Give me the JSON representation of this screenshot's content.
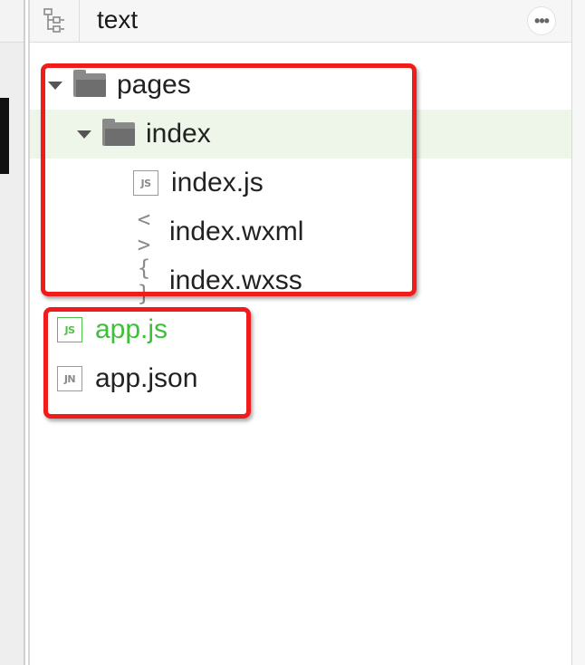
{
  "header": {
    "title": "text",
    "more_label": "•••"
  },
  "tree": {
    "pages": {
      "label": "pages",
      "index": {
        "label": "index",
        "files": [
          {
            "label": "index.js",
            "icon": "JS"
          },
          {
            "label": "index.wxml",
            "icon": "< >"
          },
          {
            "label": "index.wxss",
            "icon": "{ }"
          }
        ]
      }
    },
    "root_files": [
      {
        "label": "app.js",
        "icon": "JS",
        "color": "#3fbf3a"
      },
      {
        "label": "app.json",
        "icon": "JN"
      }
    ]
  },
  "colors": {
    "highlight": "#f01c1c",
    "selected_row": "#eef6ea",
    "accent_green": "#3fbf3a"
  }
}
